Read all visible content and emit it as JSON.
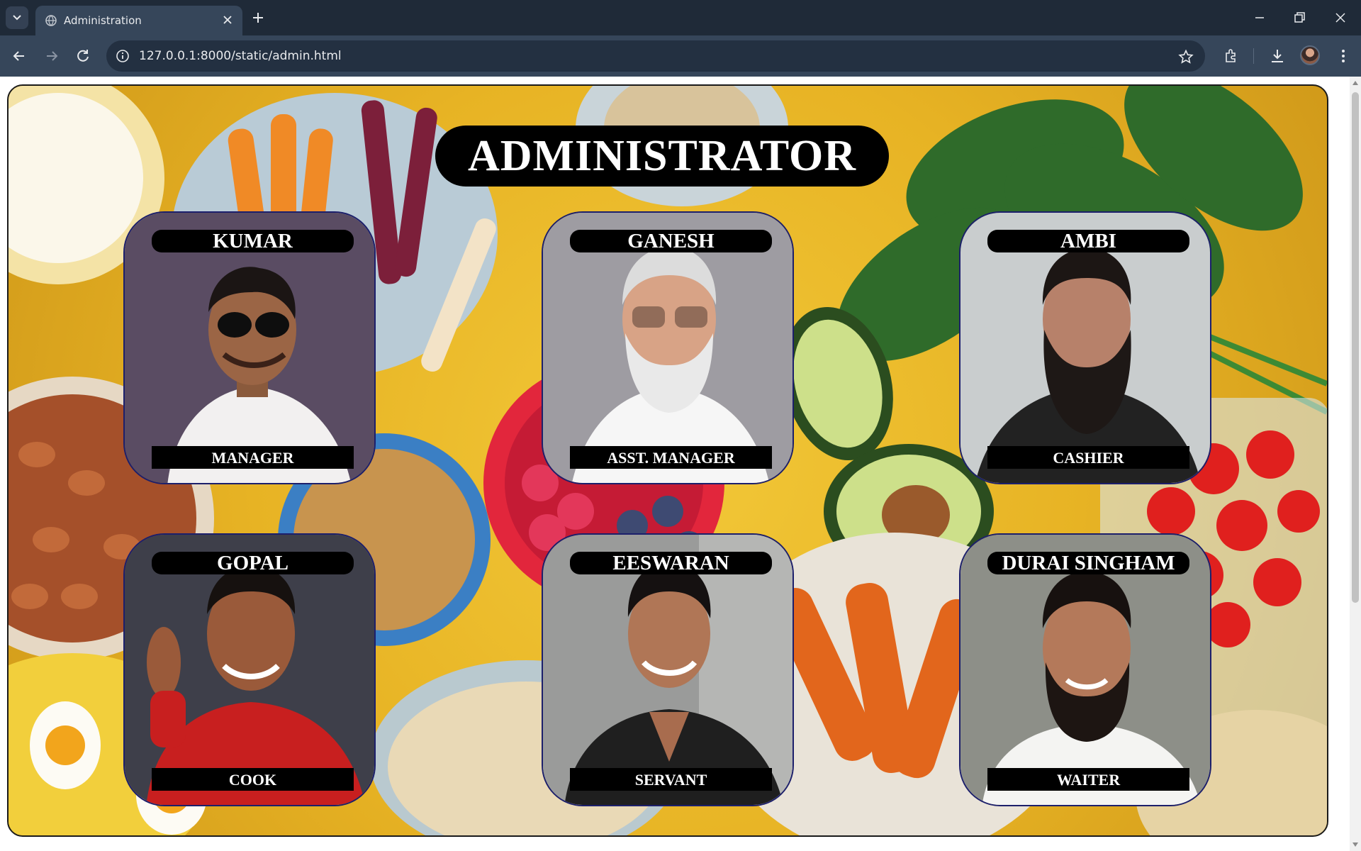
{
  "browser": {
    "tab_title": "Administration",
    "url": "127.0.0.1:8000/static/admin.html",
    "colors": {
      "tabbar": "#1f2a38",
      "toolbar": "#36465a",
      "omnibox": "#233041"
    }
  },
  "page": {
    "title": "ADMINISTRATOR",
    "staff": [
      {
        "name": "KUMAR",
        "role": "MANAGER"
      },
      {
        "name": "GANESH",
        "role": "ASST. MANAGER"
      },
      {
        "name": "AMBI",
        "role": "CASHIER"
      },
      {
        "name": "GOPAL",
        "role": "COOK"
      },
      {
        "name": "EESWARAN",
        "role": "SERVANT"
      },
      {
        "name": "DURAI SINGHAM",
        "role": "WAITER"
      }
    ],
    "colors": {
      "background": "#e7b324",
      "label_bg": "#000000",
      "label_text": "#ffffff",
      "card_border": "#1c1f6b"
    }
  }
}
